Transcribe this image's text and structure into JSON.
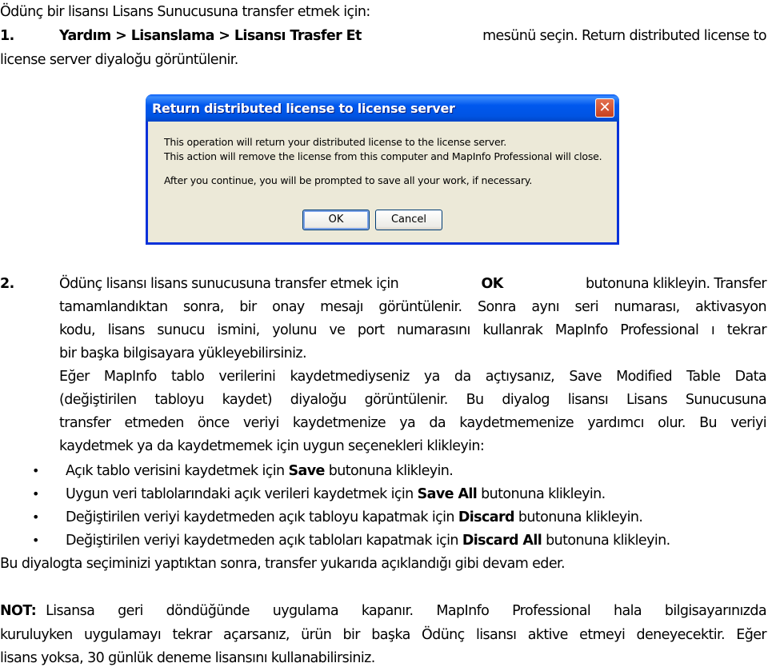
{
  "intro": "Ödünç bir lisansı Lisans Sunucusuna transfer etmek için:",
  "step1": {
    "number": "1.",
    "bold": "Yardım > Lisanslama > Lisansı Trasfer Et",
    "rest_line1": "mesünü seçin. Return distributed license to",
    "line2": "license server diyaloğu görüntülenir."
  },
  "dialog": {
    "title": "Return distributed license to license server",
    "close_icon": "close-icon",
    "messages": [
      "This operation will return your distributed license to the license server.",
      "This action will remove the license from this computer and MapInfo Professional will close.",
      "After you continue, you will be prompted to save all your work, if necessary."
    ],
    "ok_label": "OK",
    "cancel_label": "Cancel"
  },
  "step2": {
    "number": "2.",
    "line1_a": "Ödünç lisansı lisans sunucusuna transfer etmek için",
    "line1_bold": "OK",
    "line1_b": "butonuna klikleyin. Transfer",
    "line2": "tamamlandıktan sonra, bir onay mesajı görüntülenir. Sonra aynı seri numarası, aktivasyon",
    "line3": "kodu, lisans sunucu ismini, yolunu ve port numarasını kullanrak MapInfo Professional ı tekrar",
    "line4": "bir başka bilgisayara yükleyebilirsiniz.",
    "line5": "Eğer MapInfo tablo verilerini kaydetmediyseniz ya da açtıysanız, Save Modified Table Data",
    "line6": "(değiştirilen tabloyu kaydet) diyaloğu görüntülenir. Bu diyalog lisansı Lisans Sunucusuna",
    "line7": "transfer etmeden önce veriyi kaydetmenize ya da kaydetmemenize yardımcı olur. Bu veriyi",
    "line8": "kaydetmek ya da kaydetmemek için uygun seçenekleri klikleyin:"
  },
  "bullets": [
    {
      "a": "Açık tablo verisini kaydetmek için",
      "bold": "Save",
      "b": "butonuna klikleyin."
    },
    {
      "a": "Uygun veri tablolarındaki açık verileri kaydetmek için",
      "bold": "Save All",
      "b": "butonuna klikleyin."
    },
    {
      "a": "Değiştirilen veriyi kaydetmeden açık tabloyu kapatmak için",
      "bold": "Discard",
      "b": "butonuna klikleyin."
    },
    {
      "a": "Değiştirilen veriyi kaydetmeden açık tabloları kapatmak için",
      "bold": "Discard All",
      "b": "butonuna klikleyin."
    }
  ],
  "after_bullets": "Bu diyalogta seçiminizi yaptıktan sonra, transfer yukarıda açıklandığı gibi devam eder.",
  "note": {
    "label": "NOT:",
    "line1": "Lisansa geri döndüğünde uygulama kapanır. MapInfo Professional hala bilgisayarınızda",
    "line2": "kuruluyken uygulamayı tekrar açarsanız, ürün bir başka Ödünç lisansı aktive etmeyi deneyecektir. Eğer",
    "line3": "lisans yoksa, 30 günlük deneme lisansını kullanabilirsiniz."
  }
}
